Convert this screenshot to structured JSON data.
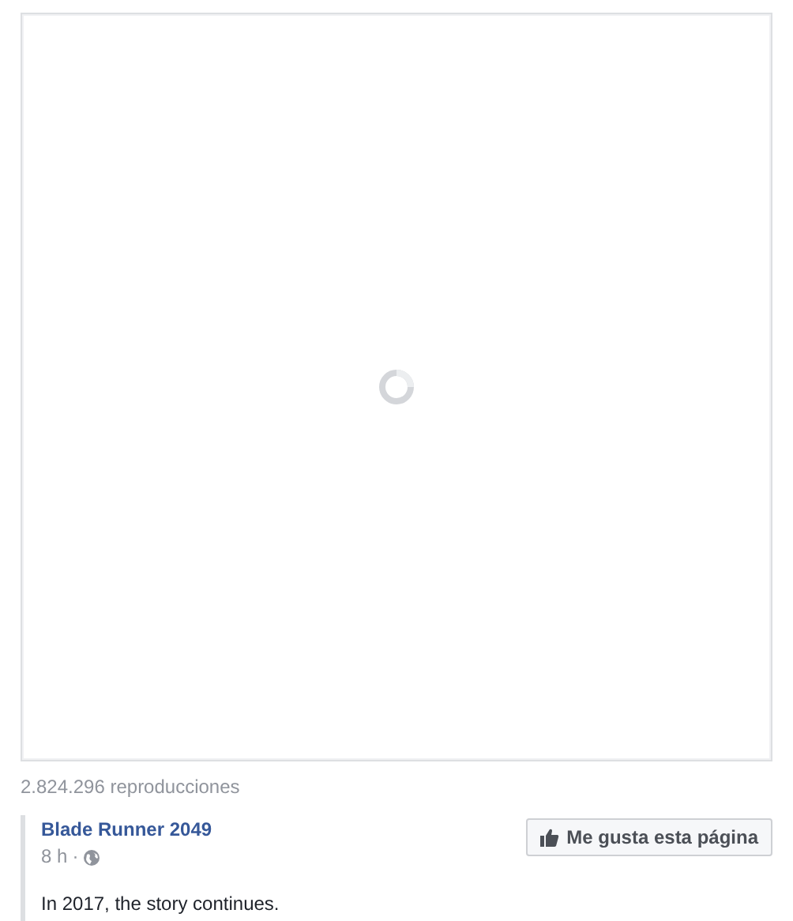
{
  "video": {
    "loading": true
  },
  "views": "2.824.296 reproducciones",
  "post": {
    "author": "Blade Runner 2049",
    "time": "8 h",
    "separator": "·",
    "like_button": "Me gusta esta página",
    "text": "In 2017, the story continues."
  }
}
